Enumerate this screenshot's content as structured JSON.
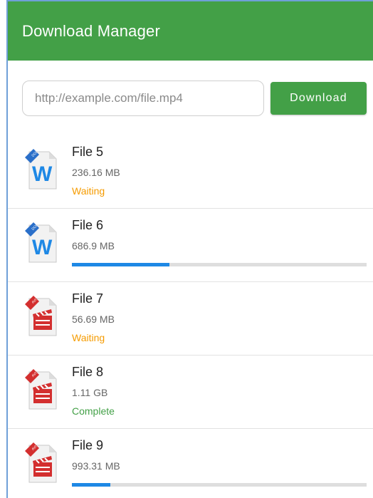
{
  "appbar": {
    "title": "Download Manager"
  },
  "url_bar": {
    "placeholder": "http://example.com/file.mp4",
    "value": "",
    "button_label": "Download"
  },
  "colors": {
    "accent": "#43a047",
    "waiting": "#f59b00",
    "progress": "#1e88e5"
  },
  "files": [
    {
      "name": "File 5",
      "size": "236.16 MB",
      "status": "Waiting",
      "status_type": "waiting",
      "icon": "docx-word-icon"
    },
    {
      "name": "File 6",
      "size": "686.9 MB",
      "status": "",
      "status_type": "progress",
      "progress": 0.33,
      "icon": "docx-word-icon"
    },
    {
      "name": "File 7",
      "size": "56.69 MB",
      "status": "Waiting",
      "status_type": "waiting",
      "icon": "avi-video-icon"
    },
    {
      "name": "File 8",
      "size": "1.11 GB",
      "status": "Complete",
      "status_type": "complete",
      "icon": "avi-video-icon"
    },
    {
      "name": "File 9",
      "size": "993.31 MB",
      "status": "",
      "status_type": "progress",
      "progress": 0.13,
      "icon": "avi-video-icon"
    }
  ]
}
